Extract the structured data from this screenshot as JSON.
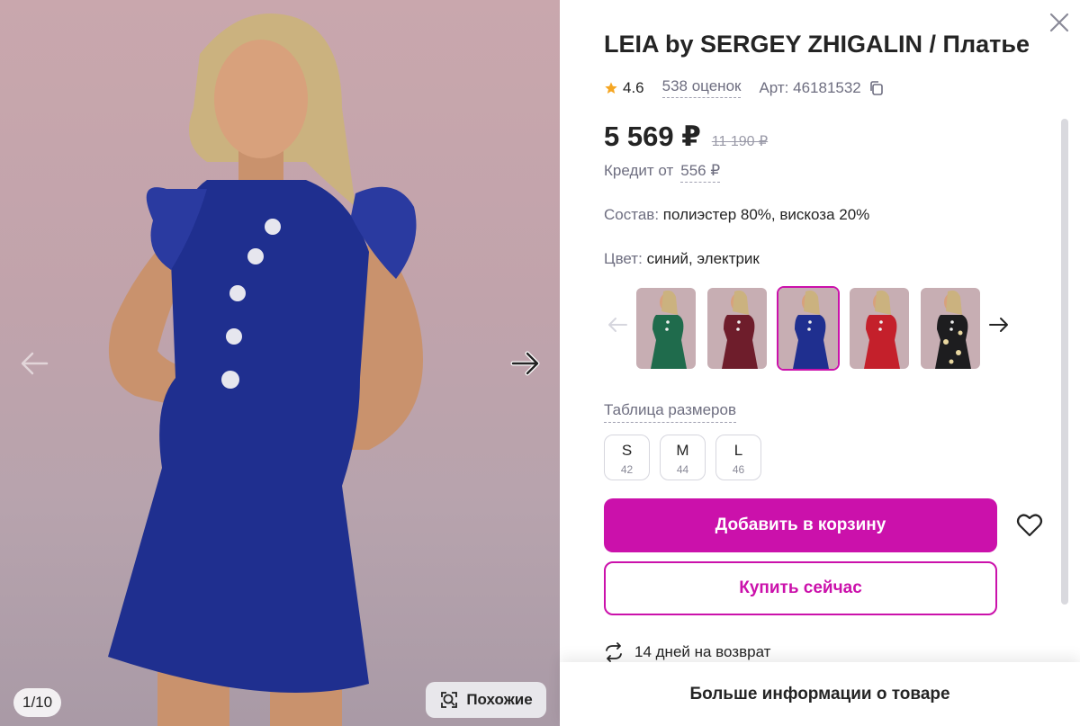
{
  "gallery": {
    "counter": "1/10",
    "similar_label": "Похожие",
    "icons": {
      "prev": "arrow-left-icon",
      "next": "arrow-right-icon",
      "similar": "search-similar-icon"
    }
  },
  "product": {
    "title": "LEIA by SERGEY ZHIGALIN / Платье",
    "rating": "4.6",
    "reviews": "538 оценок",
    "article": "Арт: 46181532",
    "price": "5 569 ₽",
    "old_price": "11 190 ₽",
    "credit_label": "Кредит от",
    "credit_amount": "556 ₽",
    "composition_label": "Состав:",
    "composition_value": "полиэстер 80%, вискоза 20%",
    "color_label": "Цвет:",
    "color_value": "синий, электрик"
  },
  "color_variants": [
    {
      "name": "green",
      "color": "#1f6b4c",
      "active": false
    },
    {
      "name": "burgundy",
      "color": "#6e1d2b",
      "active": false
    },
    {
      "name": "blue",
      "color": "#1f2f8f",
      "active": true
    },
    {
      "name": "red",
      "color": "#c4202b",
      "active": false
    },
    {
      "name": "black-floral",
      "color": "#1d1d1f",
      "active": false
    }
  ],
  "sizes": {
    "table_label": "Таблица размеров",
    "items": [
      {
        "label": "S",
        "ru": "42"
      },
      {
        "label": "M",
        "ru": "44"
      },
      {
        "label": "L",
        "ru": "46"
      }
    ]
  },
  "actions": {
    "add_to_cart": "Добавить в корзину",
    "buy_now": "Купить сейчас",
    "return_policy": "14 дней на возврат",
    "more_info": "Больше информации о товаре"
  },
  "colors": {
    "accent": "#cb11ab",
    "dress": "#1f2f8f",
    "star": "#f5a623"
  }
}
